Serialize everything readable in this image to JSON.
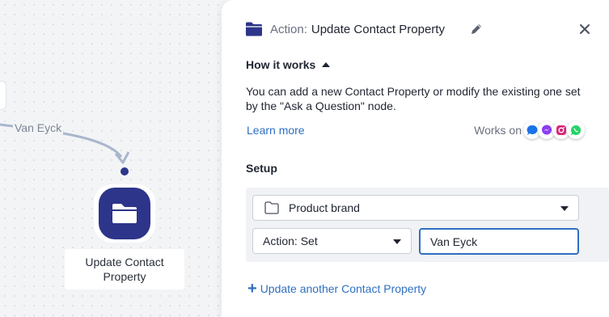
{
  "canvas": {
    "edge_label": "Van Eyck",
    "node_label": "Update Contact Property",
    "node_icon": "folder-icon"
  },
  "panel": {
    "header": {
      "prefix": "Action:",
      "title": "Update Contact Property",
      "icon": "folder-icon"
    },
    "how_it_works": {
      "label": "How it works",
      "description": "You can add a new Contact Property or modify the existing one set by the \"Ask a Question\" node.",
      "learn_more": "Learn more",
      "works_on_label": "Works on",
      "channels": [
        "messenger-chat-icon",
        "facebook-messenger-icon",
        "instagram-icon",
        "whatsapp-icon"
      ]
    },
    "setup": {
      "title": "Setup",
      "property_select": "Product brand",
      "action_select": "Action: Set",
      "value_input": "Van Eyck"
    },
    "add_another": "Update another Contact Property"
  },
  "colors": {
    "accent": "#2f6fc1",
    "node_fill": "#2c3589",
    "edge": "#a9b6cc"
  }
}
